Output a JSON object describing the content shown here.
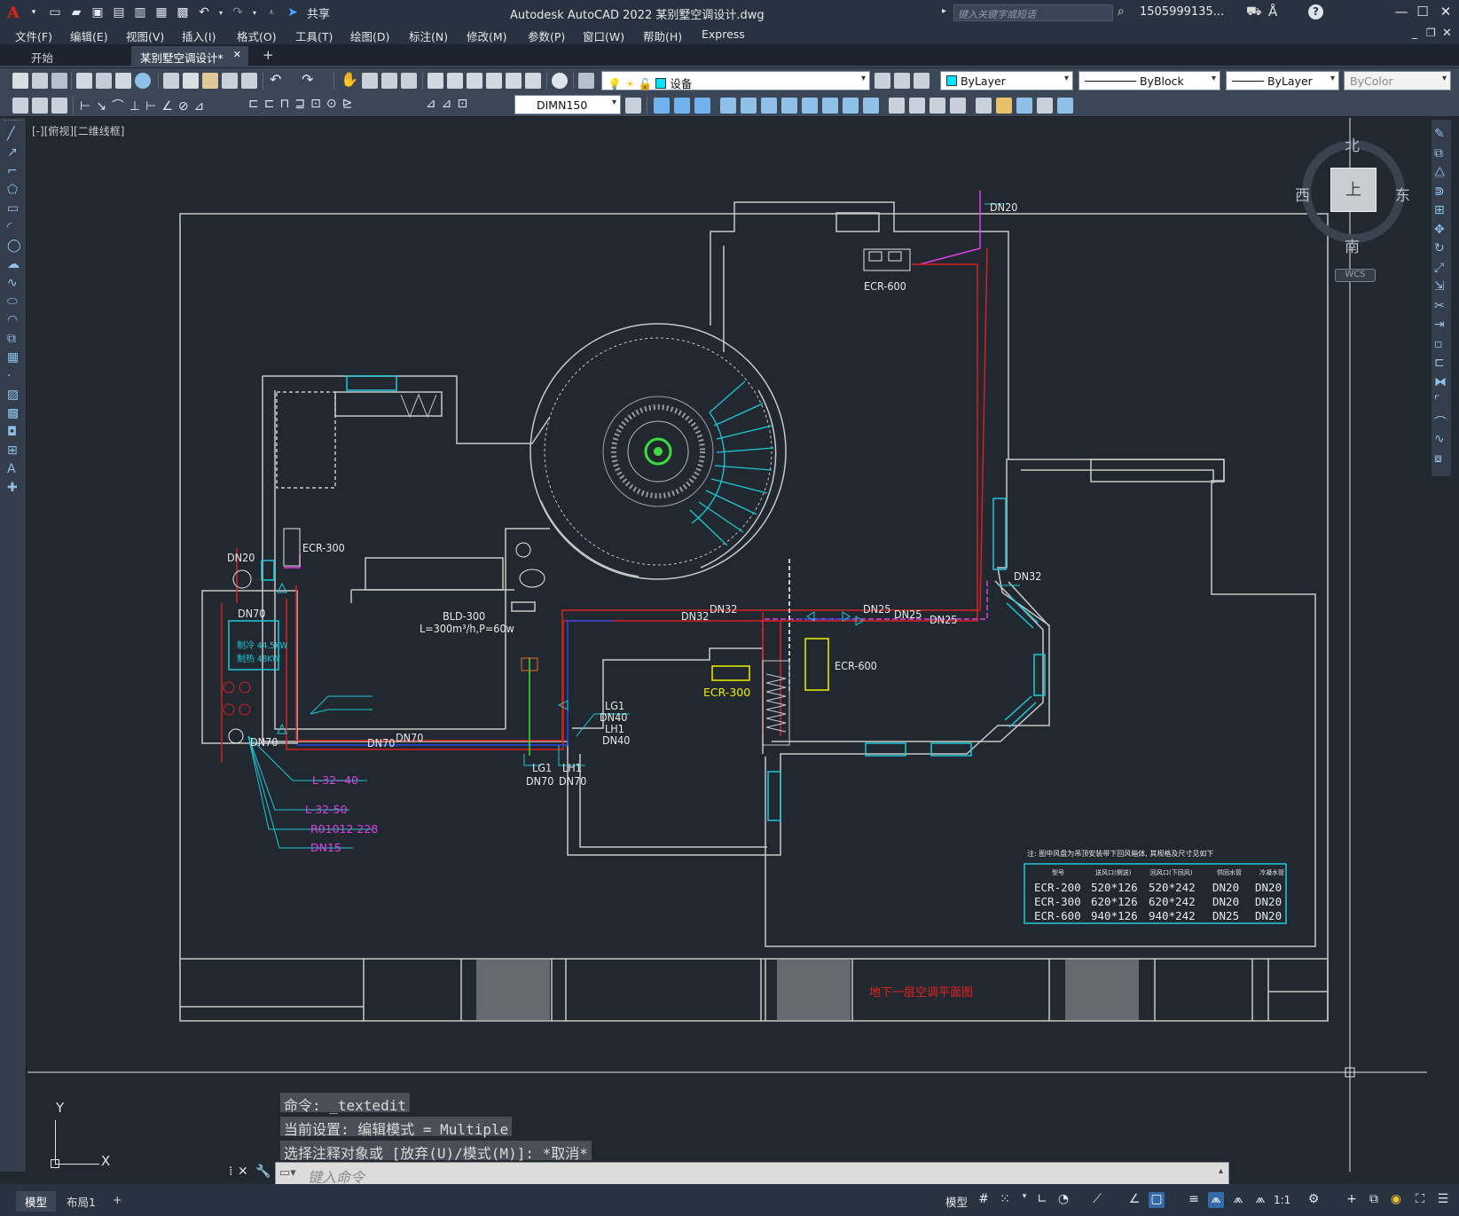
{
  "app": {
    "logo": "A",
    "title": "Autodesk AutoCAD 2022    某别墅空调设计.dwg",
    "share_label": "共享",
    "search_placeholder": "键入关键字或短语",
    "user": "1505999135...",
    "help": "?"
  },
  "menu": [
    "文件(F)",
    "编辑(E)",
    "视图(V)",
    "插入(I)",
    "格式(O)",
    "工具(T)",
    "绘图(D)",
    "标注(N)",
    "修改(M)",
    "参数(P)",
    "窗口(W)",
    "帮助(H)",
    "Express"
  ],
  "tabs": [
    {
      "label": "开始"
    },
    {
      "label": "某别墅空调设计*",
      "close": "✕"
    },
    {
      "label": "+"
    }
  ],
  "toolbar": {
    "layer": "设备",
    "color": "ByLayer",
    "linetype": "ByBlock",
    "lineweight": "ByLayer",
    "plotstyle": "ByColor",
    "dimstyle": "DIMN150"
  },
  "viewport_label": "[-][俯视][二维线框]",
  "viewcube": {
    "north": "北",
    "south": "南",
    "east": "东",
    "west": "西",
    "top": "上",
    "wcs": "WCS"
  },
  "drawing": {
    "labels_white": {
      "ecr600_top": "ECR-600",
      "ecr300_left": "ECR-300",
      "ecr600_right": "ECR-600",
      "dn20_top": "DN20",
      "dn20_left": "DN20",
      "dn70_a": "DN70",
      "dn70_b": "DN70",
      "dn70_c": "DN70",
      "dn70_d": "DN70",
      "dn32_a": "DN32",
      "dn32_b": "DN32",
      "dn32_c": "DN32",
      "dn25_a": "DN25",
      "dn25_b": "DN25",
      "dn25_c": "DN25",
      "bld": "BLD-300",
      "bld_spec": "L=300m³/h,P=60w",
      "lg1_a": "LG1",
      "dn40_a": "DN40",
      "lh1_a": "LH1",
      "dn40_b": "DN40",
      "lg1_b": "LG1",
      "dn70_e": "DN70",
      "lh1_b": "LH1",
      "dn70_f": "DN70",
      "heat_cool": "制冷 44.5KW",
      "heat_warm": "制热 48KW"
    },
    "labels_yellow": {
      "ecr300_mid": "ECR-300"
    },
    "labels_magenta": {
      "spec1": "L-32--40",
      "spec2": "L-32-50",
      "spec3": "R01012 228",
      "spec4": "DN15"
    },
    "title_red": "地下一层空调平面图",
    "table": {
      "note": "注: 图中风盘为吊顶安装带下回风箱体, 其规格及尺寸见如下",
      "headers": [
        "型号",
        "送风口(侧送)",
        "回风口(下回风)",
        "供回水管",
        "冷凝水管"
      ],
      "rows": [
        [
          "ECR-200",
          "520*126",
          "520*242",
          "DN20",
          "DN20"
        ],
        [
          "ECR-300",
          "620*126",
          "620*242",
          "DN20",
          "DN20"
        ],
        [
          "ECR-600",
          "940*126",
          "940*242",
          "DN25",
          "DN20"
        ]
      ]
    }
  },
  "command": {
    "history": [
      "命令: _textedit",
      "当前设置: 编辑模式 = Multiple",
      "选择注释对象或 [放弃(U)/模式(M)]: *取消*"
    ],
    "placeholder": "键入命令"
  },
  "ucs": {
    "x": "X",
    "y": "Y"
  },
  "status": {
    "model_tab": "模型",
    "layout_tab": "布局1",
    "add": "+",
    "model_label": "模型",
    "scale": "1:1"
  }
}
